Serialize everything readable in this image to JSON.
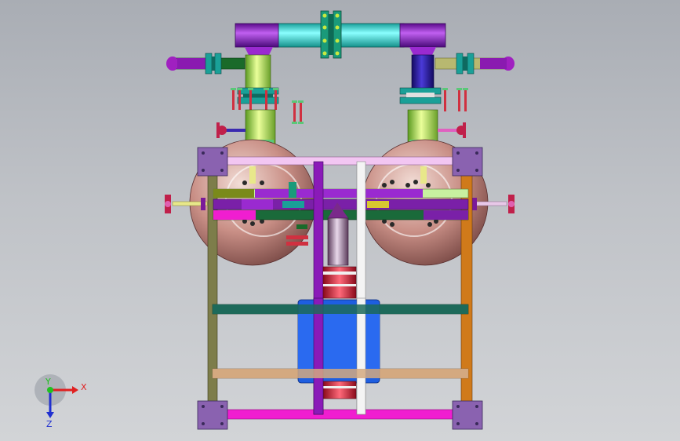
{
  "viewport": {
    "background_top": "#a9adb4",
    "background_bottom": "#d2d4d7"
  },
  "triad": {
    "x_label": "X",
    "y_label": "Y",
    "z_label": "Z",
    "x_color": "#e02020",
    "y_color": "#20c020",
    "z_color": "#2030d0"
  },
  "model": {
    "colors": {
      "top_pipe_purple": "#8a1fb8",
      "top_pipe_cyan": "#22e0d0",
      "left_riser": "#e6f58a",
      "right_riser": "#2a1aa8",
      "tank": "#c98f86",
      "frame_left": "#7d7d4a",
      "frame_right": "#d07a1a",
      "beam_green": "#1d6a5a",
      "beam_tan": "#d4a980",
      "beam_magenta": "#f01ed0",
      "pad": "#8a62b0",
      "motor": "#1e5ee0",
      "coupling": "#e02838"
    }
  }
}
